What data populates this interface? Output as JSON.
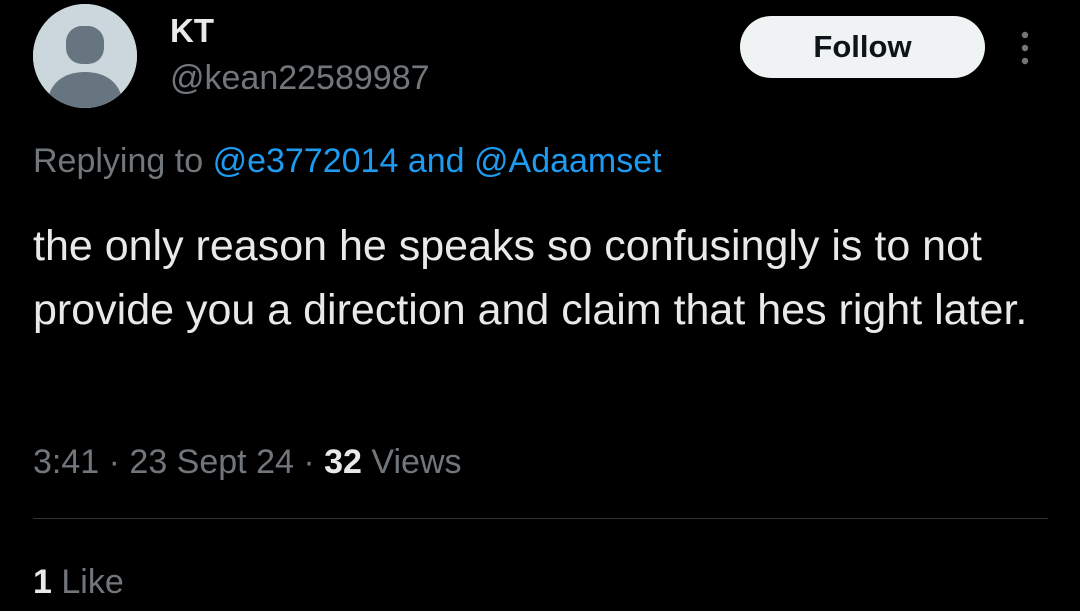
{
  "author": {
    "name": "KT",
    "handle": "@kean22589987",
    "avatar_icon": "default-profile-icon"
  },
  "follow_label": "Follow",
  "more_icon": "more-vertical-icon",
  "reply": {
    "prefix": "Replying to",
    "mention1": "@e3772014",
    "joiner": "and",
    "mention2": "@Adaamset"
  },
  "tweet_text": "the only reason he speaks so confusingly is to not provide you a direction and claim that hes right later.",
  "meta": {
    "time": "3:41",
    "sep1": "·",
    "date": "23 Sept 24",
    "sep2": "·",
    "views_count": "32",
    "views_label": "Views"
  },
  "likes": {
    "count": "1",
    "label": "Like"
  },
  "colors": {
    "background": "#000000",
    "text": "#e7e9ea",
    "secondary": "#71767b",
    "link": "#1d9bf0",
    "follow_bg": "#eff3f4"
  }
}
